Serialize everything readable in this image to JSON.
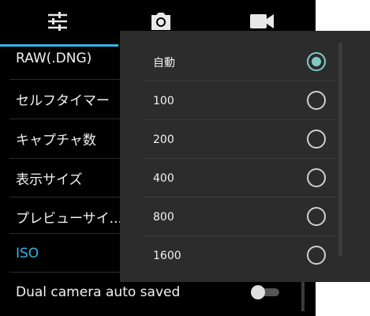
{
  "tabs": [
    {
      "name": "settings",
      "icon": "sliders-icon"
    },
    {
      "name": "photo",
      "icon": "camera-icon"
    },
    {
      "name": "video",
      "icon": "video-camera-icon"
    }
  ],
  "settings": {
    "items": [
      {
        "label": "RAW(.DNG)"
      },
      {
        "label": "セルフタイマー"
      },
      {
        "label": "キャプチャ数"
      },
      {
        "label": "表示サイズ"
      },
      {
        "label": "プレビューサイ..."
      },
      {
        "label": "ISO"
      },
      {
        "label": "Dual camera auto saved",
        "toggle": "off"
      }
    ]
  },
  "iso_dialog": {
    "options": [
      {
        "label": "自動",
        "selected": true
      },
      {
        "label": "100",
        "selected": false
      },
      {
        "label": "200",
        "selected": false
      },
      {
        "label": "400",
        "selected": false
      },
      {
        "label": "800",
        "selected": false
      },
      {
        "label": "1600",
        "selected": false
      }
    ]
  },
  "colors": {
    "accent": "#33b5e5",
    "radio_selected": "#80cbc4",
    "background": "#000000",
    "dialog": "#2c2c2c"
  }
}
